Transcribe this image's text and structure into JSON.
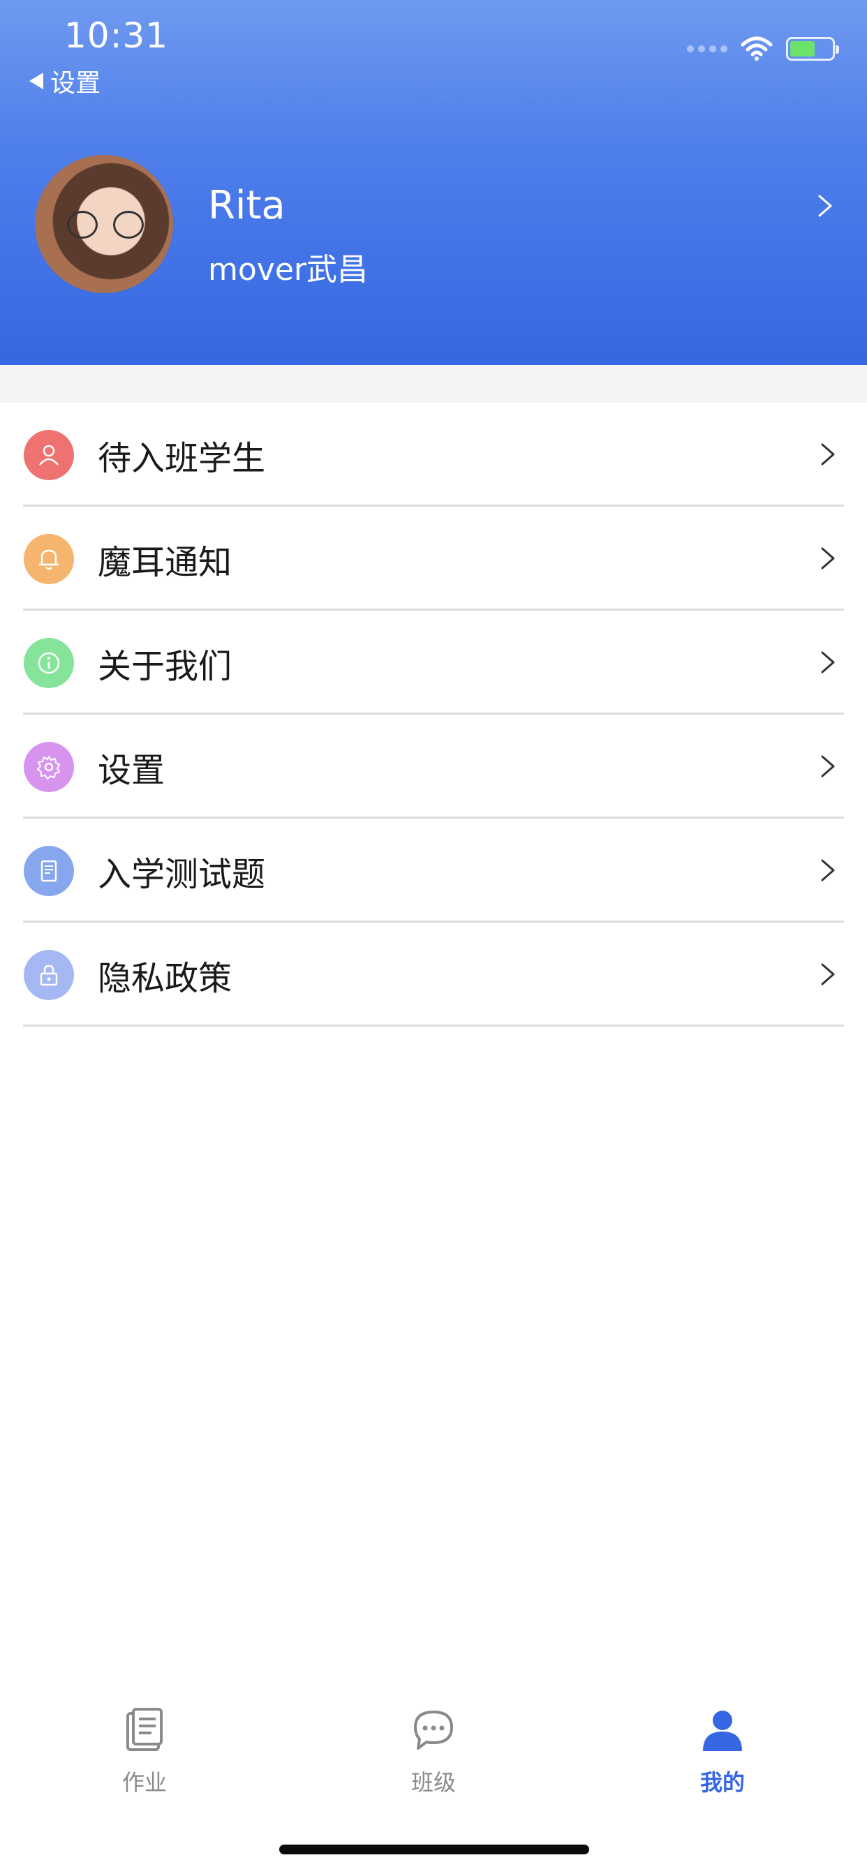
{
  "status_bar": {
    "time": "10:31",
    "back_label": "设置"
  },
  "profile": {
    "name": "Rita",
    "subtitle": "mover武昌"
  },
  "menu": {
    "items": [
      {
        "label": "待入班学生",
        "icon": "person-icon",
        "color": "#ee7270"
      },
      {
        "label": "魔耳通知",
        "icon": "bell-icon",
        "color": "#f5b56e"
      },
      {
        "label": "关于我们",
        "icon": "info-icon",
        "color": "#86e39a"
      },
      {
        "label": "设置",
        "icon": "gear-icon",
        "color": "#d694ee"
      },
      {
        "label": "入学测试题",
        "icon": "document-icon",
        "color": "#86a6ee"
      },
      {
        "label": "隐私政策",
        "icon": "lock-icon",
        "color": "#a6b8f3"
      }
    ]
  },
  "tabbar": {
    "tabs": [
      {
        "label": "作业",
        "icon": "homework-icon",
        "active": false
      },
      {
        "label": "班级",
        "icon": "chat-icon",
        "active": false
      },
      {
        "label": "我的",
        "icon": "person-icon",
        "active": true
      }
    ]
  },
  "colors": {
    "accent": "#3567e2",
    "header_top": "#6f9af0",
    "header_bottom": "#3567e2"
  }
}
